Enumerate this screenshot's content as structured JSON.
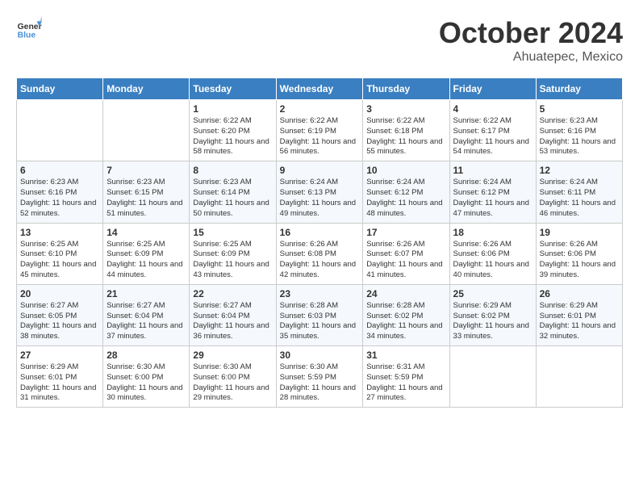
{
  "logo": {
    "line1": "General",
    "line2": "Blue"
  },
  "title": "October 2024",
  "location": "Ahuatepec, Mexico",
  "weekdays": [
    "Sunday",
    "Monday",
    "Tuesday",
    "Wednesday",
    "Thursday",
    "Friday",
    "Saturday"
  ],
  "weeks": [
    [
      {
        "day": null
      },
      {
        "day": null
      },
      {
        "day": 1,
        "sunrise": "6:22 AM",
        "sunset": "6:20 PM",
        "daylight": "11 hours and 58 minutes."
      },
      {
        "day": 2,
        "sunrise": "6:22 AM",
        "sunset": "6:19 PM",
        "daylight": "11 hours and 56 minutes."
      },
      {
        "day": 3,
        "sunrise": "6:22 AM",
        "sunset": "6:18 PM",
        "daylight": "11 hours and 55 minutes."
      },
      {
        "day": 4,
        "sunrise": "6:22 AM",
        "sunset": "6:17 PM",
        "daylight": "11 hours and 54 minutes."
      },
      {
        "day": 5,
        "sunrise": "6:23 AM",
        "sunset": "6:16 PM",
        "daylight": "11 hours and 53 minutes."
      }
    ],
    [
      {
        "day": 6,
        "sunrise": "6:23 AM",
        "sunset": "6:16 PM",
        "daylight": "11 hours and 52 minutes."
      },
      {
        "day": 7,
        "sunrise": "6:23 AM",
        "sunset": "6:15 PM",
        "daylight": "11 hours and 51 minutes."
      },
      {
        "day": 8,
        "sunrise": "6:23 AM",
        "sunset": "6:14 PM",
        "daylight": "11 hours and 50 minutes."
      },
      {
        "day": 9,
        "sunrise": "6:24 AM",
        "sunset": "6:13 PM",
        "daylight": "11 hours and 49 minutes."
      },
      {
        "day": 10,
        "sunrise": "6:24 AM",
        "sunset": "6:12 PM",
        "daylight": "11 hours and 48 minutes."
      },
      {
        "day": 11,
        "sunrise": "6:24 AM",
        "sunset": "6:12 PM",
        "daylight": "11 hours and 47 minutes."
      },
      {
        "day": 12,
        "sunrise": "6:24 AM",
        "sunset": "6:11 PM",
        "daylight": "11 hours and 46 minutes."
      }
    ],
    [
      {
        "day": 13,
        "sunrise": "6:25 AM",
        "sunset": "6:10 PM",
        "daylight": "11 hours and 45 minutes."
      },
      {
        "day": 14,
        "sunrise": "6:25 AM",
        "sunset": "6:09 PM",
        "daylight": "11 hours and 44 minutes."
      },
      {
        "day": 15,
        "sunrise": "6:25 AM",
        "sunset": "6:09 PM",
        "daylight": "11 hours and 43 minutes."
      },
      {
        "day": 16,
        "sunrise": "6:26 AM",
        "sunset": "6:08 PM",
        "daylight": "11 hours and 42 minutes."
      },
      {
        "day": 17,
        "sunrise": "6:26 AM",
        "sunset": "6:07 PM",
        "daylight": "11 hours and 41 minutes."
      },
      {
        "day": 18,
        "sunrise": "6:26 AM",
        "sunset": "6:06 PM",
        "daylight": "11 hours and 40 minutes."
      },
      {
        "day": 19,
        "sunrise": "6:26 AM",
        "sunset": "6:06 PM",
        "daylight": "11 hours and 39 minutes."
      }
    ],
    [
      {
        "day": 20,
        "sunrise": "6:27 AM",
        "sunset": "6:05 PM",
        "daylight": "11 hours and 38 minutes."
      },
      {
        "day": 21,
        "sunrise": "6:27 AM",
        "sunset": "6:04 PM",
        "daylight": "11 hours and 37 minutes."
      },
      {
        "day": 22,
        "sunrise": "6:27 AM",
        "sunset": "6:04 PM",
        "daylight": "11 hours and 36 minutes."
      },
      {
        "day": 23,
        "sunrise": "6:28 AM",
        "sunset": "6:03 PM",
        "daylight": "11 hours and 35 minutes."
      },
      {
        "day": 24,
        "sunrise": "6:28 AM",
        "sunset": "6:02 PM",
        "daylight": "11 hours and 34 minutes."
      },
      {
        "day": 25,
        "sunrise": "6:29 AM",
        "sunset": "6:02 PM",
        "daylight": "11 hours and 33 minutes."
      },
      {
        "day": 26,
        "sunrise": "6:29 AM",
        "sunset": "6:01 PM",
        "daylight": "11 hours and 32 minutes."
      }
    ],
    [
      {
        "day": 27,
        "sunrise": "6:29 AM",
        "sunset": "6:01 PM",
        "daylight": "11 hours and 31 minutes."
      },
      {
        "day": 28,
        "sunrise": "6:30 AM",
        "sunset": "6:00 PM",
        "daylight": "11 hours and 30 minutes."
      },
      {
        "day": 29,
        "sunrise": "6:30 AM",
        "sunset": "6:00 PM",
        "daylight": "11 hours and 29 minutes."
      },
      {
        "day": 30,
        "sunrise": "6:30 AM",
        "sunset": "5:59 PM",
        "daylight": "11 hours and 28 minutes."
      },
      {
        "day": 31,
        "sunrise": "6:31 AM",
        "sunset": "5:59 PM",
        "daylight": "11 hours and 27 minutes."
      },
      {
        "day": null
      },
      {
        "day": null
      }
    ]
  ]
}
